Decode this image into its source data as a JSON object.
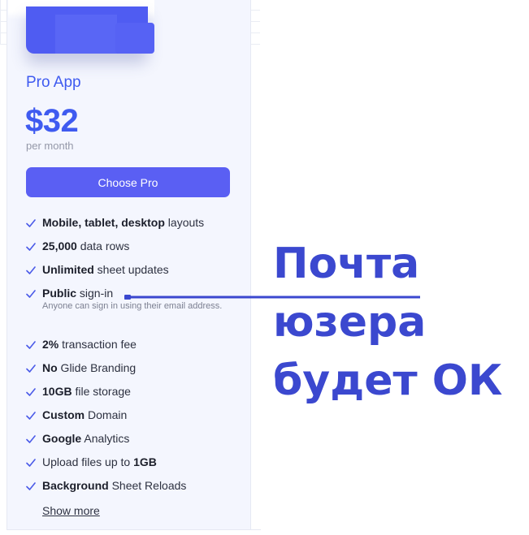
{
  "plan": {
    "name": "Pro App",
    "price": "$32",
    "period": "per month",
    "cta_label": "Choose Pro"
  },
  "features": [
    {
      "parts": [
        {
          "t": "Mobile, tablet, desktop",
          "b": true
        },
        {
          "t": " layouts",
          "b": false
        }
      ]
    },
    {
      "parts": [
        {
          "t": "25,000",
          "b": true
        },
        {
          "t": " data rows",
          "b": false
        }
      ]
    },
    {
      "parts": [
        {
          "t": "Unlimited",
          "b": true
        },
        {
          "t": " sheet updates",
          "b": false
        }
      ]
    },
    {
      "parts": [
        {
          "t": "Public",
          "b": true
        },
        {
          "t": " sign-in",
          "b": false
        }
      ],
      "note": "Anyone can sign in using their email address."
    },
    {
      "parts": [
        {
          "t": "2%",
          "b": true
        },
        {
          "t": " transaction fee",
          "b": false
        }
      ]
    },
    {
      "parts": [
        {
          "t": "No",
          "b": true
        },
        {
          "t": " Glide Branding",
          "b": false
        }
      ]
    },
    {
      "parts": [
        {
          "t": "10GB",
          "b": true
        },
        {
          "t": " file storage",
          "b": false
        }
      ]
    },
    {
      "parts": [
        {
          "t": "Custom",
          "b": true
        },
        {
          "t": " Domain",
          "b": false
        }
      ]
    },
    {
      "parts": [
        {
          "t": "Google",
          "b": true
        },
        {
          "t": " Analytics",
          "b": false
        }
      ]
    },
    {
      "parts": [
        {
          "t": "Upload files up to ",
          "b": false
        },
        {
          "t": "1GB",
          "b": true
        }
      ]
    },
    {
      "parts": [
        {
          "t": "Background",
          "b": true
        },
        {
          "t": " Sheet Reloads",
          "b": false
        }
      ]
    }
  ],
  "show_more_label": "Show more",
  "annotation": {
    "text": "Почта\nюзера\nбудет ОК",
    "color": "#3b48cf"
  },
  "colors": {
    "accent": "#3f5bf0",
    "button": "#5a5ff3",
    "check": "#4a5ae8",
    "card_bg": "#f4f6fe"
  },
  "icons": {
    "check": "check-icon"
  }
}
